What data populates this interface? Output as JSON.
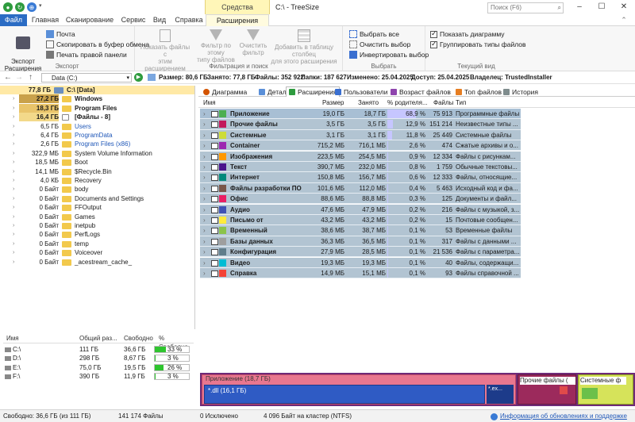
{
  "window": {
    "title": "C:\\ - TreeSize",
    "context_tab_group": "Средства расширения",
    "search_placeholder": "Поиск (F6)"
  },
  "tabs": [
    "Файл",
    "Главная",
    "Сканирование",
    "Сервис",
    "Вид",
    "Справка",
    "Расширения"
  ],
  "ribbon": {
    "export_label": "Экспорт\nРасширения",
    "mail": "Почта",
    "copy": "Скопировать в буфер обмена",
    "print": "Печать правой панели",
    "export_group": "Экспорт",
    "show_files": "Показать файлы с\nэтим расширением",
    "filter_type": "Фильтр по этому\nтипу файлов",
    "clear_filter": "Очистить\nфильтр",
    "add_column": "Добавить в таблицу столбец\nдля этого расширения",
    "filter_group": "Фильтрация и поиск",
    "select_all": "Выбрать все",
    "clear_sel": "Очистить выбор",
    "invert": "Инвертировать выбор",
    "select_group": "Выбрать",
    "show_chart": "Показать диаграмму",
    "group_types": "Группировать типы файлов",
    "view_group": "Текущий вид"
  },
  "address": {
    "path": "Data (C:)",
    "size": "Размер: 80,6 ГБ",
    "used": "Занято: 77,8 ГБ",
    "files": "Файлы: 352 922",
    "folders": "Папки: 187 627",
    "changed": "Изменено: 25.04.2025",
    "access": "Доступ: 25.04.2025",
    "owner": "Владелец: TrustedInstaller"
  },
  "tree": [
    {
      "size": "77,8 ГБ",
      "name": "C:\\  [Data]",
      "lvl": 0,
      "bold": true,
      "color": "#1a1a1a",
      "sel": true
    },
    {
      "size": "27,2 ГБ",
      "name": "Windows",
      "lvl": 1,
      "bold": true,
      "color": "#1a1a1a",
      "hl": "#c9a14b"
    },
    {
      "size": "18,3 ГБ",
      "name": "Program Files",
      "lvl": 1,
      "bold": true,
      "color": "#1a1a1a",
      "hl": "#e9c46a"
    },
    {
      "size": "16,4 ГБ",
      "name": "[Файлы - 8]",
      "lvl": 1,
      "bold": true,
      "color": "#1a1a1a",
      "hl": "#f3d98a",
      "file": true
    },
    {
      "size": "6,5 ГБ",
      "name": "Users",
      "lvl": 1,
      "bold": false,
      "color": "#1f57b8"
    },
    {
      "size": "6,4 ГБ",
      "name": "ProgramData",
      "lvl": 1,
      "bold": false,
      "color": "#1f57b8"
    },
    {
      "size": "2,6 ГБ",
      "name": "Program Files (x86)",
      "lvl": 1,
      "bold": false,
      "color": "#1f57b8"
    },
    {
      "size": "322,9 МБ",
      "name": "System Volume Information",
      "lvl": 1,
      "bold": false,
      "color": "#1a1a1a"
    },
    {
      "size": "18,5 МБ",
      "name": "Boot",
      "lvl": 1,
      "bold": false,
      "color": "#1a1a1a"
    },
    {
      "size": "14,1 МБ",
      "name": "$Recycle.Bin",
      "lvl": 1,
      "bold": false,
      "color": "#1a1a1a"
    },
    {
      "size": "4,0 КБ",
      "name": "Recovery",
      "lvl": 1,
      "bold": false,
      "color": "#1a1a1a"
    },
    {
      "size": "0 Байт",
      "name": "body",
      "lvl": 1,
      "bold": false,
      "color": "#1a1a1a"
    },
    {
      "size": "0 Байт",
      "name": "Documents and Settings",
      "lvl": 1,
      "bold": false,
      "color": "#1a1a1a"
    },
    {
      "size": "0 Байт",
      "name": "FFOutput",
      "lvl": 1,
      "bold": false,
      "color": "#1a1a1a"
    },
    {
      "size": "0 Байт",
      "name": "Games",
      "lvl": 1,
      "bold": false,
      "color": "#1a1a1a"
    },
    {
      "size": "0 Байт",
      "name": "inetpub",
      "lvl": 1,
      "bold": false,
      "color": "#1a1a1a"
    },
    {
      "size": "0 Байт",
      "name": "PerfLogs",
      "lvl": 1,
      "bold": false,
      "color": "#1a1a1a"
    },
    {
      "size": "0 Байт",
      "name": "temp",
      "lvl": 1,
      "bold": false,
      "color": "#1a1a1a"
    },
    {
      "size": "0 Байт",
      "name": "Voiceover",
      "lvl": 1,
      "bold": false,
      "color": "#1a1a1a"
    },
    {
      "size": "0 Байт",
      "name": "_acestream_cache_",
      "lvl": 1,
      "bold": false,
      "color": "#1a1a1a"
    }
  ],
  "drives": {
    "headers": [
      "Имя",
      "Общий раз...",
      "Свободно",
      "% Свободно"
    ],
    "rows": [
      {
        "name": "C:\\",
        "total": "111 ГБ",
        "free": "36,6 ГБ",
        "pct": "33 %",
        "pct_value": 33
      },
      {
        "name": "D:\\",
        "total": "298 ГБ",
        "free": "8,67 ГБ",
        "pct": "3 %",
        "pct_value": 3
      },
      {
        "name": "E:\\",
        "total": "75,0 ГБ",
        "free": "19,5 ГБ",
        "pct": "26 %",
        "pct_value": 26
      },
      {
        "name": "F:\\",
        "total": "390 ГБ",
        "free": "11,9 ГБ",
        "pct": "3 %",
        "pct_value": 3
      }
    ]
  },
  "right_tabs": [
    "Диаграмма",
    "Детали",
    "Расширения",
    "Пользователи",
    "Возраст файлов",
    "Топ файлов",
    "История"
  ],
  "grid": {
    "headers": [
      "Имя",
      "Размер",
      "Занято",
      "% родителя...",
      "Файлы",
      "Тип"
    ],
    "rows": [
      {
        "name": "Приложение",
        "size": "19,0 ГБ",
        "alloc": "18,7 ГБ",
        "pct": "68,9 %",
        "pct_value": 68.9,
        "files": "75 913",
        "type": "Программные файлы",
        "color": "#4caf50"
      },
      {
        "name": "Прочие файлы",
        "size": "3,5 ГБ",
        "alloc": "3,5 ГБ",
        "pct": "12,9 %",
        "pct_value": 12.9,
        "files": "151 214",
        "type": "Неизвестные типы ...",
        "color": "#c2185b"
      },
      {
        "name": "Системные",
        "size": "3,1 ГБ",
        "alloc": "3,1 ГБ",
        "pct": "11,8 %",
        "pct_value": 11.8,
        "files": "25 449",
        "type": "Системные файлы",
        "color": "#cddc39"
      },
      {
        "name": "Container",
        "size": "715,2 МБ",
        "alloc": "716,1 МБ",
        "pct": "2,6 %",
        "pct_value": 2.6,
        "files": "474",
        "type": "Сжатые архивы и о...",
        "color": "#9c27b0"
      },
      {
        "name": "Изображения",
        "size": "223,5 МБ",
        "alloc": "254,5 МБ",
        "pct": "0,9 %",
        "pct_value": 0.9,
        "files": "12 334",
        "type": "Файлы с рисункам...",
        "color": "#ff9800"
      },
      {
        "name": "Текст",
        "size": "390,7 МБ",
        "alloc": "232,0 МБ",
        "pct": "0,8 %",
        "pct_value": 0.8,
        "files": "1 759",
        "type": "Обычные текстовы...",
        "color": "#4a148c"
      },
      {
        "name": "Интернет",
        "size": "150,8 МБ",
        "alloc": "156,7 МБ",
        "pct": "0,6 %",
        "pct_value": 0.6,
        "files": "12 333",
        "type": "Файлы, относящие...",
        "color": "#00897b"
      },
      {
        "name": "Файлы разработки ПО",
        "size": "101,6 МБ",
        "alloc": "112,0 МБ",
        "pct": "0,4 %",
        "pct_value": 0.4,
        "files": "5 463",
        "type": "Исходный код и фа...",
        "color": "#795548"
      },
      {
        "name": "Офис",
        "size": "88,6 МБ",
        "alloc": "88,8 МБ",
        "pct": "0,3 %",
        "pct_value": 0.3,
        "files": "125",
        "type": "Документы и файл...",
        "color": "#e91e63"
      },
      {
        "name": "Аудио",
        "size": "47,6 МБ",
        "alloc": "47,9 МБ",
        "pct": "0,2 %",
        "pct_value": 0.2,
        "files": "216",
        "type": "Файлы с музыкой, з...",
        "color": "#3f51b5"
      },
      {
        "name": "Письмо от",
        "size": "43,2 МБ",
        "alloc": "43,2 МБ",
        "pct": "0,2 %",
        "pct_value": 0.2,
        "files": "15",
        "type": "Почтовые сообщен...",
        "color": "#ffeb3b"
      },
      {
        "name": "Временный",
        "size": "38,6 МБ",
        "alloc": "38,7 МБ",
        "pct": "0,1 %",
        "pct_value": 0.1,
        "files": "53",
        "type": "Временные файлы",
        "color": "#8bc34a"
      },
      {
        "name": "Базы данных",
        "size": "36,3 МБ",
        "alloc": "36,5 МБ",
        "pct": "0,1 %",
        "pct_value": 0.1,
        "files": "317",
        "type": "Файлы с данными ...",
        "color": "#9e9e9e"
      },
      {
        "name": "Конфигурация",
        "size": "27,9 МБ",
        "alloc": "28,5 МБ",
        "pct": "0,1 %",
        "pct_value": 0.1,
        "files": "21 536",
        "type": "Файлы с параметра...",
        "color": "#607d8b"
      },
      {
        "name": "Видео",
        "size": "19,3 МБ",
        "alloc": "19,3 МБ",
        "pct": "0,1 %",
        "pct_value": 0.1,
        "files": "40",
        "type": "Файлы, содержащи...",
        "color": "#00bcd4"
      },
      {
        "name": "Справка",
        "size": "14,9 МБ",
        "alloc": "15,1 МБ",
        "pct": "0,1 %",
        "pct_value": 0.1,
        "files": "93",
        "type": "Файлы справочной ...",
        "color": "#f44336"
      }
    ]
  },
  "treemap": {
    "app_label": "Приложение (18,7 ГБ)",
    "dll_label": "*.dll (16,1 ГБ)",
    "other_label": "Прочие файлы (",
    "sys_label": "Системные ф",
    "ex_label": "*.ex..."
  },
  "status": {
    "free": "Свободно: 36,6 ГБ (из 111 ГБ)",
    "files": "141 174 Файлы",
    "excluded": "0 Исключено",
    "cluster": "4 096 Байт на кластер (NTFS)",
    "update": "Информация об обновлениях и поддержке"
  }
}
